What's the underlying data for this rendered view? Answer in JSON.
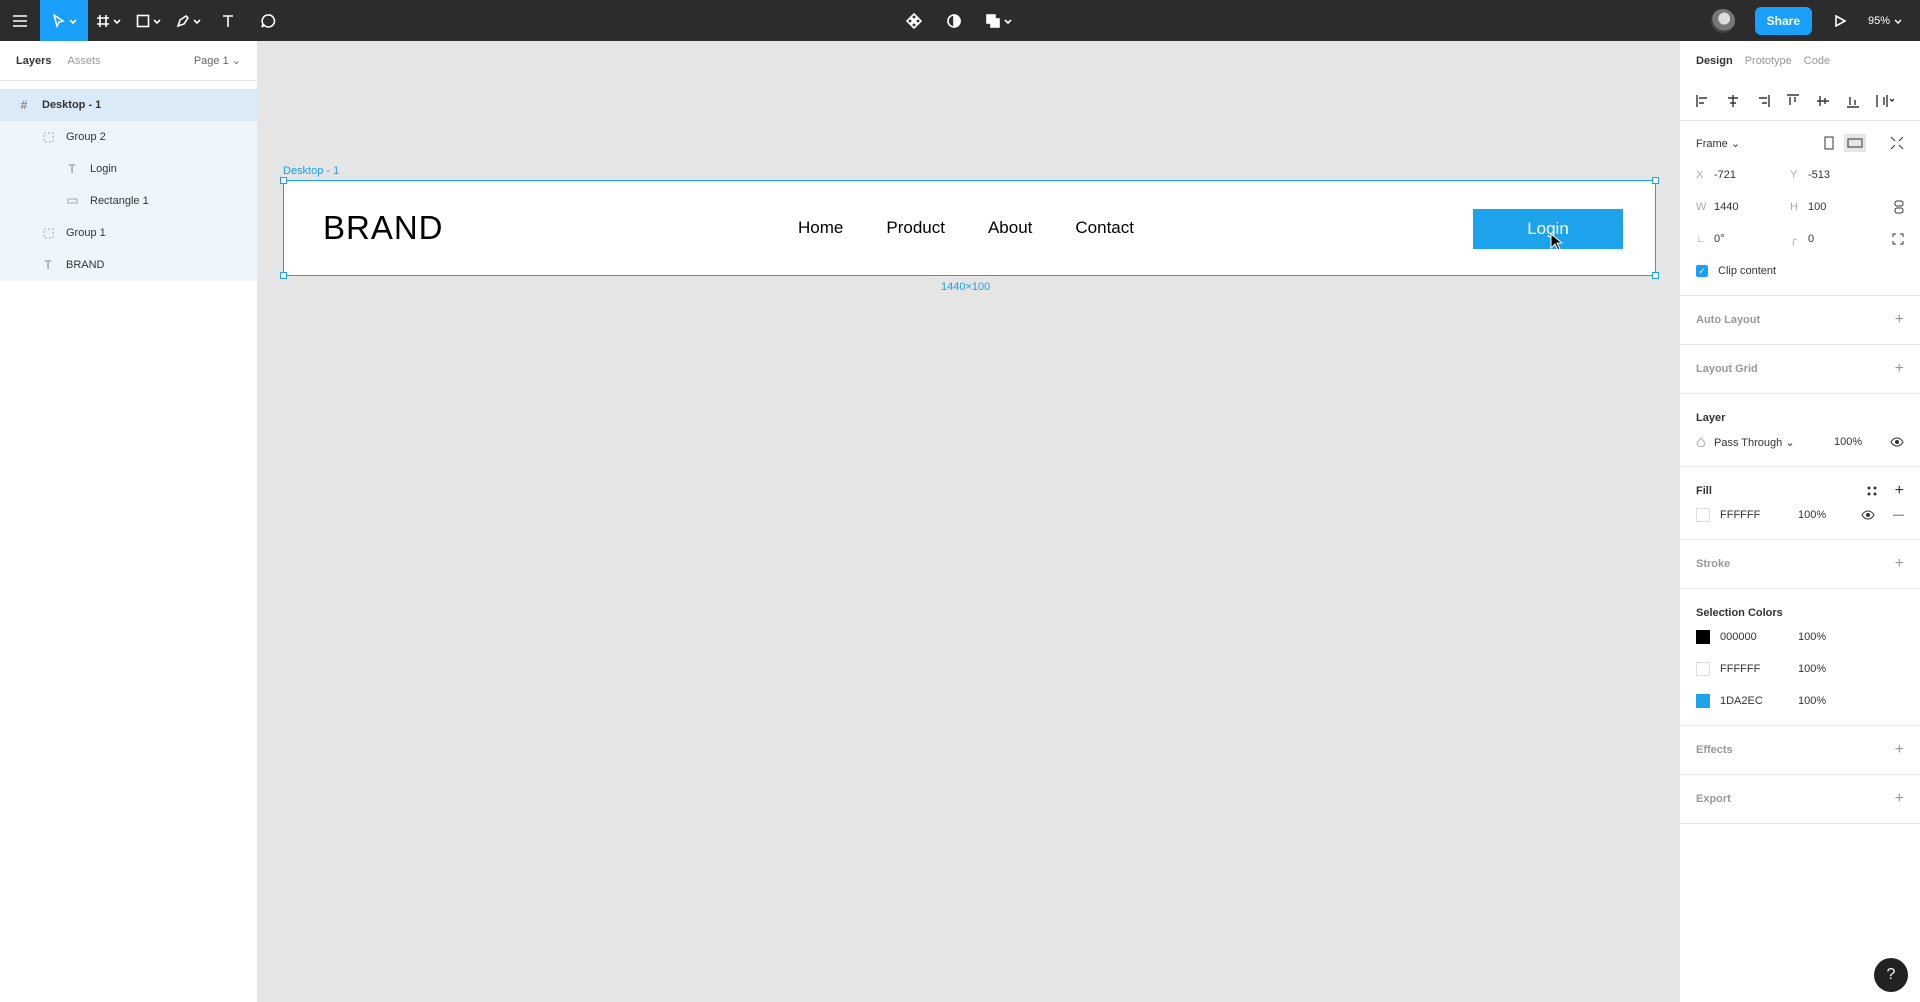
{
  "toolbar": {
    "share_label": "Share",
    "zoom": "95%"
  },
  "left_panel": {
    "tabs": [
      "Layers",
      "Assets"
    ],
    "page": "Page 1",
    "layers": [
      {
        "name": "Desktop - 1",
        "icon": "frame-icon"
      },
      {
        "name": "Group 2",
        "icon": "group-icon"
      },
      {
        "name": "Login",
        "icon": "text-icon"
      },
      {
        "name": "Rectangle 1",
        "icon": "rectangle-icon"
      },
      {
        "name": "Group 1",
        "icon": "group-icon"
      },
      {
        "name": "BRAND",
        "icon": "text-icon"
      }
    ]
  },
  "canvas": {
    "frame_label": "Desktop - 1",
    "brand": "BRAND",
    "nav": [
      "Home",
      "Product",
      "About",
      "Contact"
    ],
    "login": "Login",
    "size_label": "1440×100"
  },
  "right_panel": {
    "tabs": [
      "Design",
      "Prototype",
      "Code"
    ],
    "frame_label": "Frame",
    "x": "-721",
    "y": "-513",
    "w": "1440",
    "h": "100",
    "rotation": "0°",
    "radius": "0",
    "clip_content": "Clip content",
    "auto_layout": "Auto Layout",
    "layout_grid": "Layout Grid",
    "layer_title": "Layer",
    "blend_mode": "Pass Through",
    "layer_opacity": "100%",
    "fill_title": "Fill",
    "fill_hex": "FFFFFF",
    "fill_opacity": "100%",
    "stroke": "Stroke",
    "selection_colors_title": "Selection Colors",
    "selection_colors": [
      {
        "hex": "000000",
        "opacity": "100%",
        "color": "#000000"
      },
      {
        "hex": "FFFFFF",
        "opacity": "100%",
        "color": "#FFFFFF"
      },
      {
        "hex": "1DA2EC",
        "opacity": "100%",
        "color": "#1DA2EC"
      }
    ],
    "effects": "Effects",
    "export": "Export",
    "help": "?"
  },
  "colors": {
    "accent": "#18a0fb",
    "login_button": "#1da2ec",
    "toolbar_bg": "#2c2c2c",
    "canvas_bg": "#e5e5e5"
  }
}
